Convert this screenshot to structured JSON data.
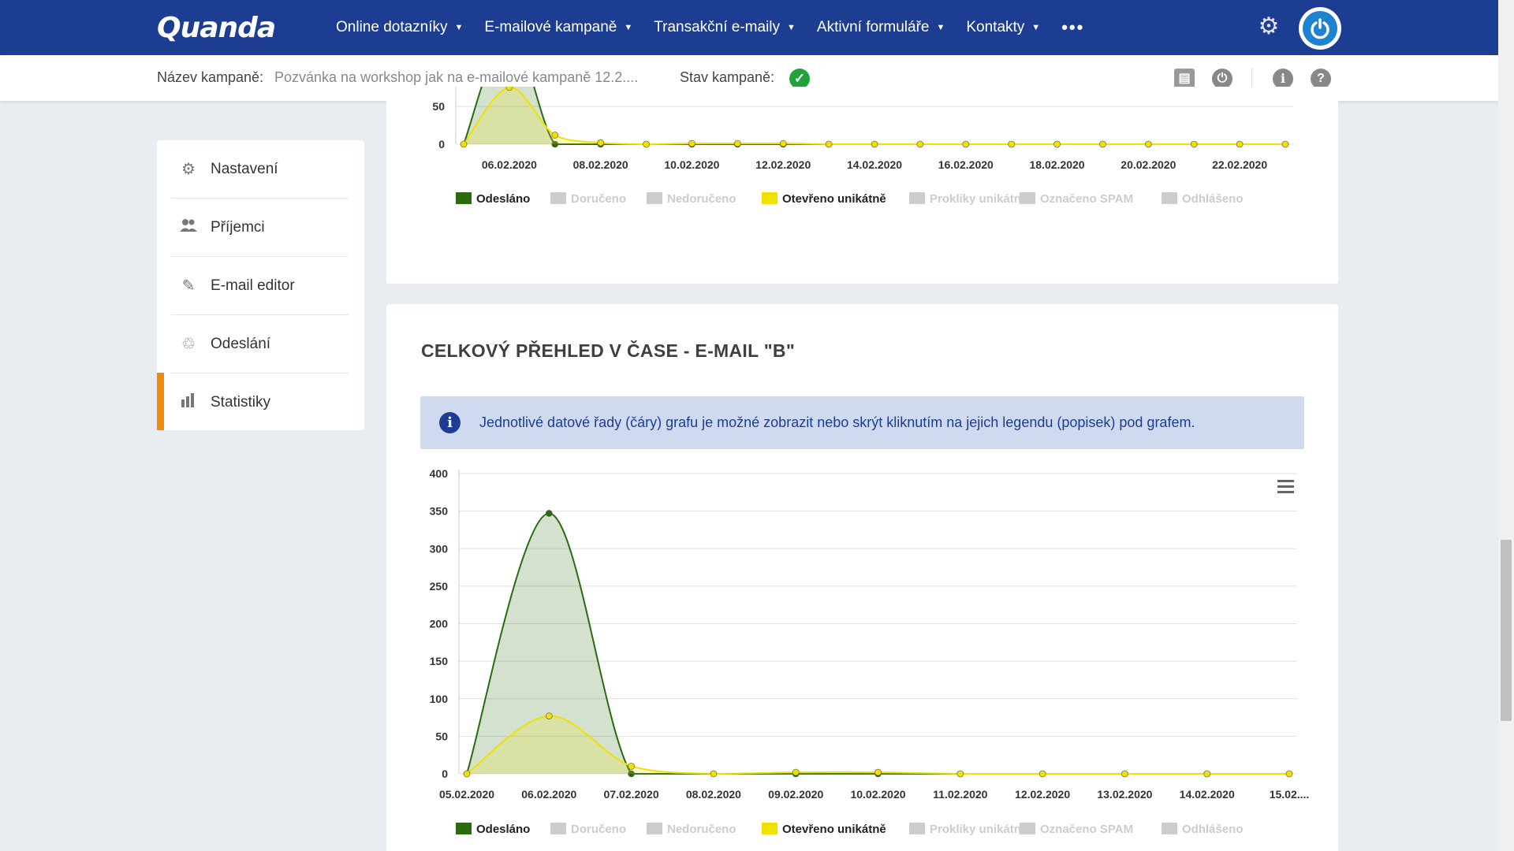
{
  "app": {
    "logo": "Quanda"
  },
  "nav": {
    "items": [
      {
        "label": "Online dotazníky"
      },
      {
        "label": "E-mailové kampaně"
      },
      {
        "label": "Transakční e-maily"
      },
      {
        "label": "Aktivní formuláře"
      },
      {
        "label": "Kontakty"
      }
    ],
    "more": "•••",
    "settings_icon": "gear-icon",
    "logout_icon": "power-icon"
  },
  "campaign": {
    "name_label": "Název kampaně:",
    "name_value": "Pozvánka na workshop jak na e-mailové kampaně 12.2....",
    "status_label": "Stav kampaně:",
    "status_icon": "check-icon",
    "status_color": "#21a33b",
    "tools": [
      {
        "icon": "report-icon",
        "glyph": "▤"
      },
      {
        "icon": "power-icon",
        "glyph": "⏻"
      },
      {
        "icon": "info-icon",
        "glyph": "i"
      },
      {
        "icon": "help-icon",
        "glyph": "?"
      }
    ]
  },
  "sidebar": {
    "items": [
      {
        "label": "Nastavení",
        "icon": "gear-icon",
        "glyph": "⚙"
      },
      {
        "label": "Příjemci",
        "icon": "users-icon",
        "glyph": "👥"
      },
      {
        "label": "E-mail editor",
        "icon": "edit-icon",
        "glyph": "✎"
      },
      {
        "label": "Odeslání",
        "icon": "send-icon",
        "glyph": "♲"
      },
      {
        "label": "Statistiky",
        "icon": "bar-chart-icon",
        "glyph": "▮"
      }
    ],
    "active_index": 4,
    "accent": "#f08a0c"
  },
  "panel_b": {
    "title": "CELKOVÝ PŘEHLED V ČASE - E-MAIL \"B\"",
    "info_text": "Jednotlivé datové řady (čáry) grafu je možné zobrazit nebo skrýt kliknutím na jejich legendu (popisek) pod grafem.",
    "info_icon": "info-icon",
    "menu_icon": "hamburger-menu-icon"
  },
  "legend": [
    {
      "name": "Odesláno",
      "color": "#2b6b10",
      "active": true
    },
    {
      "name": "Doručeno",
      "color": "#cccccc",
      "active": false
    },
    {
      "name": "Nedoručeno",
      "color": "#cccccc",
      "active": false
    },
    {
      "name": "Otevřeno unikátně",
      "color": "#f0e100",
      "active": true
    },
    {
      "name": "Prokliky unikátně",
      "color": "#cccccc",
      "active": false
    },
    {
      "name": "Označeno SPAM",
      "color": "#cccccc",
      "active": false
    },
    {
      "name": "Odhlášeno",
      "color": "#cccccc",
      "active": false
    }
  ],
  "chart_data": [
    {
      "type": "area",
      "x_labels": [
        "06.02.2020",
        "08.02.2020",
        "10.02.2020",
        "12.02.2020",
        "14.02.2020",
        "16.02.2020",
        "18.02.2020",
        "20.02.2020",
        "22.02.2020"
      ],
      "y_ticks": [
        "0",
        "50"
      ],
      "ylim": [
        0,
        50
      ],
      "series": [
        {
          "name": "Odesláno",
          "color": "#2b6b10",
          "values": [
            0,
            345,
            0,
            0,
            0,
            0,
            0,
            0,
            0,
            0,
            0,
            0,
            0,
            0,
            0,
            0,
            0,
            0,
            0
          ]
        },
        {
          "name": "Otevřeno unikátně",
          "color": "#f0e100",
          "values": [
            0,
            75,
            12,
            2,
            0,
            1,
            1,
            1,
            0,
            0,
            0,
            0,
            0,
            0,
            0,
            0,
            0,
            0,
            0
          ]
        }
      ],
      "grid": true
    },
    {
      "type": "area",
      "x_labels": [
        "05.02.2020",
        "06.02.2020",
        "07.02.2020",
        "08.02.2020",
        "09.02.2020",
        "10.02.2020",
        "11.02.2020",
        "12.02.2020",
        "13.02.2020",
        "14.02.2020",
        "15.02...."
      ],
      "y_ticks": [
        "0",
        "50",
        "100",
        "150",
        "200",
        "250",
        "300",
        "350",
        "400"
      ],
      "ylim": [
        0,
        400
      ],
      "series": [
        {
          "name": "Odesláno",
          "color": "#2b6b10",
          "values": [
            0,
            347,
            0,
            0,
            0,
            0,
            0,
            0,
            0,
            0,
            0
          ]
        },
        {
          "name": "Otevřeno unikátně",
          "color": "#f0e100",
          "values": [
            0,
            77,
            10,
            0,
            2,
            2,
            0,
            0,
            0,
            0,
            0
          ]
        }
      ],
      "grid": true,
      "legend": "bottom"
    }
  ]
}
